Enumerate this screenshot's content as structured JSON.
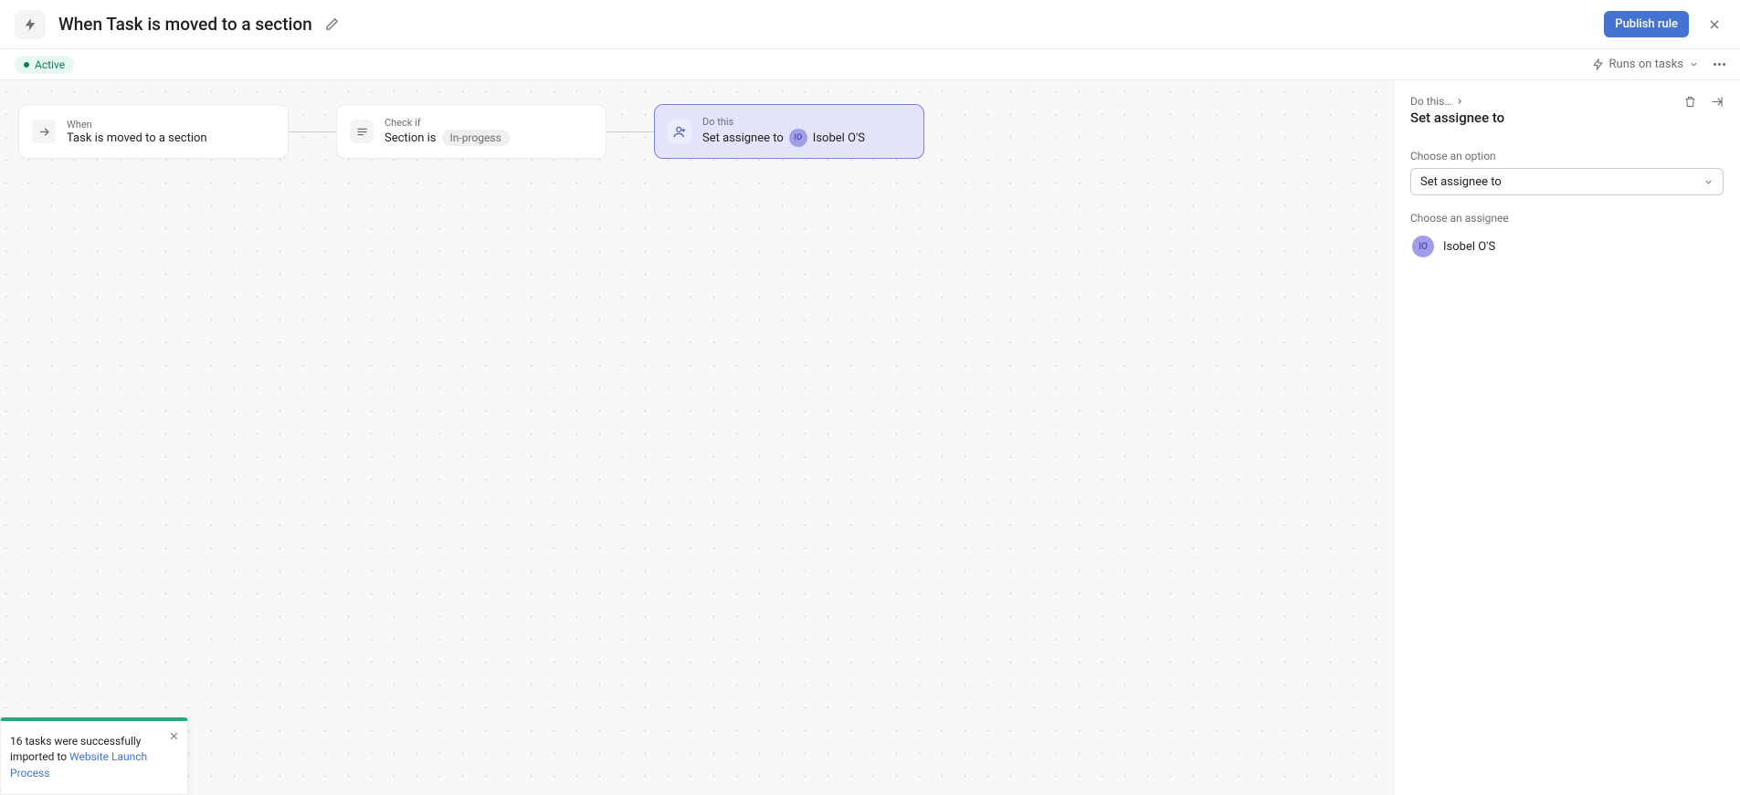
{
  "header": {
    "title": "When Task is moved to a section",
    "publish_label": "Publish rule"
  },
  "toolbar": {
    "status": "Active",
    "runs_on_label": "Runs on tasks"
  },
  "cards": {
    "trigger": {
      "label": "When",
      "desc": "Task is moved to a section"
    },
    "condition": {
      "label": "Check if",
      "desc_prefix": "Section is",
      "chip": "In-progess"
    },
    "action": {
      "label": "Do this",
      "desc_prefix": "Set assignee to",
      "avatar_initials": "IO",
      "assignee_name": "Isobel O'S"
    }
  },
  "sidepanel": {
    "breadcrumb": "Do this…",
    "title": "Set assignee to",
    "option_label": "Choose an option",
    "select_value": "Set assignee to",
    "assignee_label": "Choose an assignee",
    "assignee_initials": "IO",
    "assignee_name": "Isobel O'S"
  },
  "toast": {
    "text_prefix": "16 tasks were successfully imported to ",
    "link_text": "Website Launch Process"
  }
}
